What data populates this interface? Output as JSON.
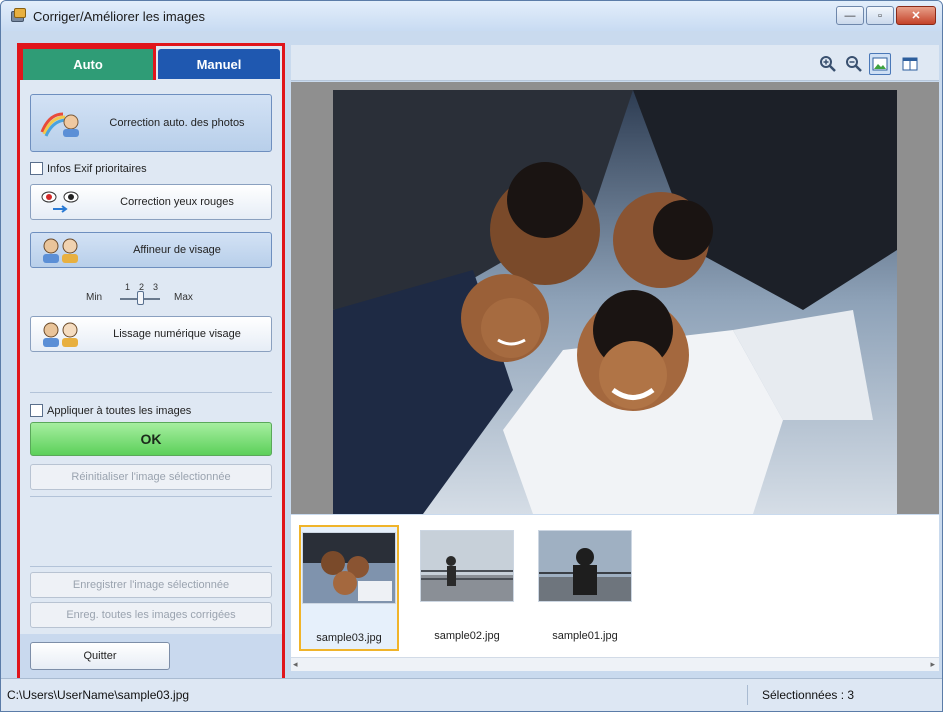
{
  "window": {
    "title": "Corriger/Améliorer les images"
  },
  "tabs": {
    "auto": "Auto",
    "manual": "Manuel"
  },
  "auto_panel": {
    "auto_photo_fix": "Correction auto. des photos",
    "exif_priority": "Infos Exif prioritaires",
    "red_eye": "Correction yeux rouges",
    "face_sharpener": "Affineur de visage",
    "slider_min": "Min",
    "slider_max": "Max",
    "slider_ticks": [
      "1",
      "2",
      "3"
    ],
    "slider_value": 2,
    "digital_face_smoothing": "Lissage numérique visage",
    "apply_all": "Appliquer à toutes les images",
    "ok": "OK",
    "reset_selected": "Réinitialiser l'image sélectionnée",
    "save_selected": "Enregistrer l'image sélectionnée",
    "save_all": "Enreg. toutes les images corrigées",
    "quit": "Quitter"
  },
  "thumbnails": [
    {
      "name": "sample03.jpg",
      "selected": true
    },
    {
      "name": "sample02.jpg",
      "selected": false
    },
    {
      "name": "sample01.jpg",
      "selected": false
    }
  ],
  "status": {
    "path": "C:\\Users\\UserName\\sample03.jpg",
    "selected_count": "Sélectionnées : 3"
  },
  "colors": {
    "highlight": "#e0151b",
    "auto_tab": "#2f9c76",
    "manual_tab": "#1f58b0",
    "ok_button": "#5cd05a"
  }
}
